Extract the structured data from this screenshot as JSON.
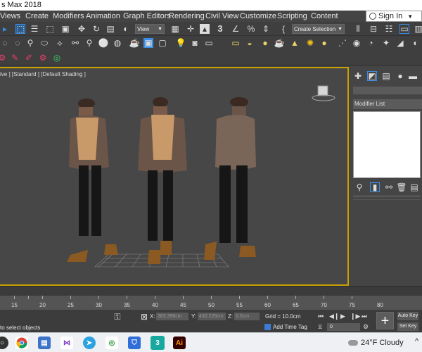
{
  "window": {
    "title": "s Max 2018"
  },
  "menu": {
    "items": [
      {
        "label": "Views"
      },
      {
        "label": "Create"
      },
      {
        "label": "Modifiers"
      },
      {
        "label": "Animation"
      },
      {
        "label": "Graph Editors"
      },
      {
        "label": "Rendering"
      },
      {
        "label": "Civil View"
      },
      {
        "label": "Customize"
      },
      {
        "label": "Scripting"
      },
      {
        "label": "Content"
      }
    ],
    "sign_in": "Sign In"
  },
  "toolbar": {
    "view_dropdown": "View",
    "selection_set_dropdown": "Create Selection Se"
  },
  "viewport": {
    "label": "ive ] [Standard ] [Default Shading ]",
    "border_color": "#c8a000"
  },
  "command_panel": {
    "modifier_list": "Modifier List"
  },
  "timeline": {
    "ticks": [
      "15",
      "20",
      "25",
      "30",
      "35",
      "40",
      "45",
      "50",
      "55",
      "60",
      "65",
      "70",
      "75",
      "80"
    ]
  },
  "status": {
    "message": "to select objects",
    "x_label": "X:",
    "x_value": "383.396cm",
    "y_label": "Y:",
    "y_value": "430.226cm",
    "z_label": "Z:",
    "z_value": "0.0cm",
    "grid": "Grid = 10.0cm",
    "add_time_tag": "Add Time Tag",
    "frame_value": "0",
    "auto_key": "Auto Key",
    "set_key": "Set Key"
  },
  "taskbar": {
    "weather": "24°F  Cloudy",
    "app_3dsmax": "3",
    "app_illustrator": "Ai"
  },
  "colors": {
    "accent": "#c8a000",
    "panel_bg": "#454545",
    "viewport_bg": "#474747",
    "taskbar_bg": "#eef0f3"
  }
}
